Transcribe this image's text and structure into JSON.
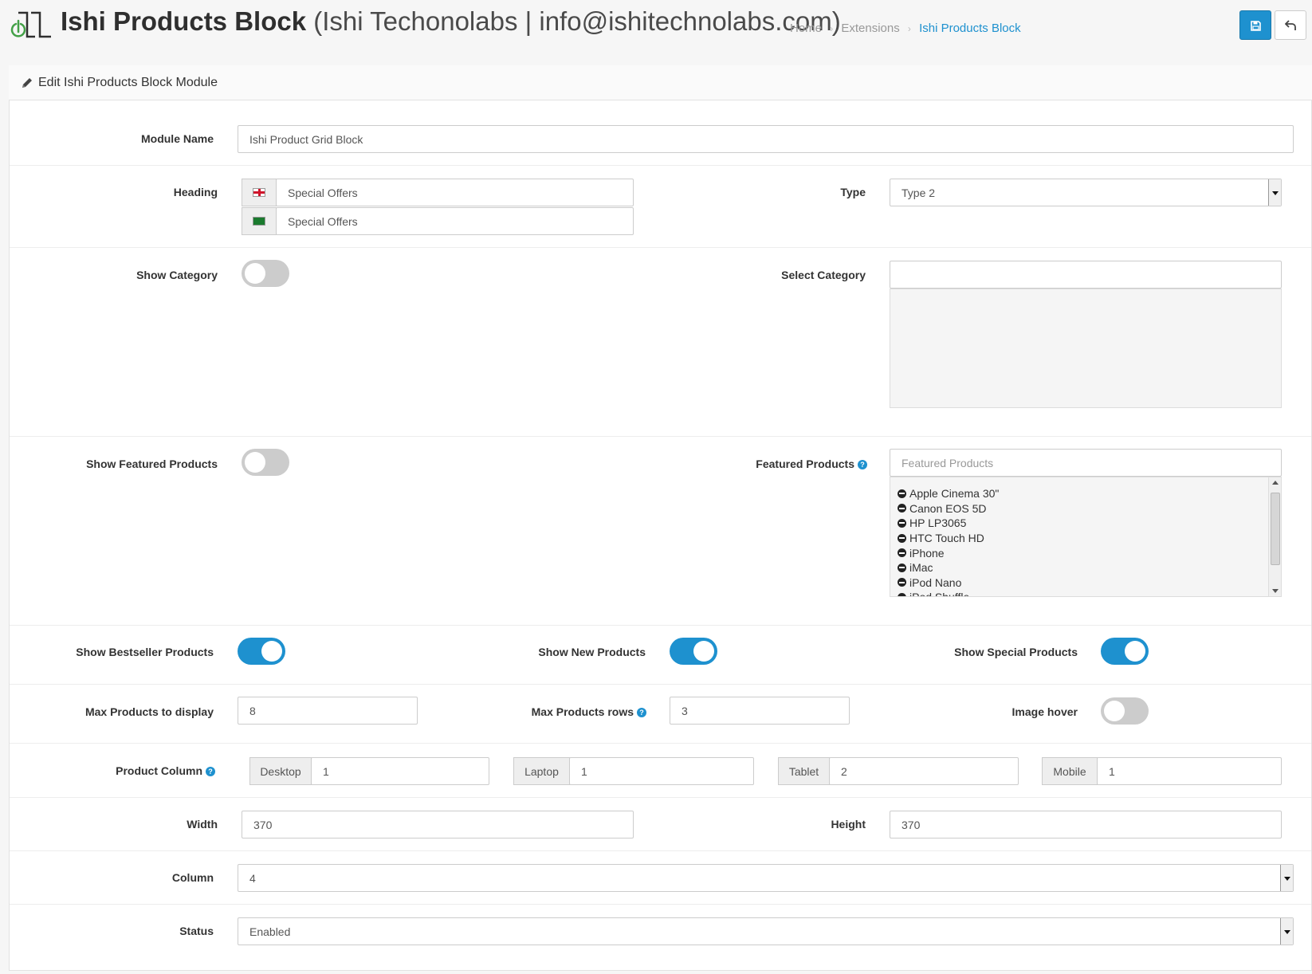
{
  "header": {
    "title": "Ishi Products Block",
    "subtitle": "(Ishi Techonolabs | info@ishitechnolabs.com)",
    "breadcrumb": [
      "Home",
      "Extensions",
      "Ishi Products Block"
    ]
  },
  "icons": {
    "logo": "ishi-logo-icon",
    "save": "save-icon",
    "back": "reply-icon",
    "pencil": "pencil-icon",
    "help": "question-circle-icon",
    "flag_en": "flag-gb-icon",
    "flag_ar": "flag-sa-icon",
    "remove": "minus-circle-icon"
  },
  "colors": {
    "primary": "#1e91cf",
    "toggle_off": "#cccccc"
  },
  "panel": {
    "title": "Edit Ishi Products Block Module"
  },
  "form": {
    "module_name": {
      "label": "Module Name",
      "value": "Ishi Product Grid Block"
    },
    "heading": {
      "label": "Heading",
      "values": [
        "Special Offers",
        "Special Offers"
      ]
    },
    "type": {
      "label": "Type",
      "value": "Type 2"
    },
    "show_category": {
      "label": "Show Category",
      "enabled": false
    },
    "select_category": {
      "label": "Select Category",
      "value": ""
    },
    "show_featured": {
      "label": "Show Featured Products",
      "enabled": false
    },
    "featured_products": {
      "label": "Featured Products",
      "placeholder": "Featured Products",
      "items": [
        "Apple Cinema 30\"",
        "Canon EOS 5D",
        "HP LP3065",
        "HTC Touch HD",
        "iPhone",
        "iMac",
        "iPod Nano",
        "iPod Shuffle"
      ]
    },
    "show_bestseller": {
      "label": "Show Bestseller Products",
      "enabled": true
    },
    "show_new": {
      "label": "Show New Products",
      "enabled": true
    },
    "show_special": {
      "label": "Show Special Products",
      "enabled": true
    },
    "max_products": {
      "label": "Max Products to display",
      "value": "8"
    },
    "max_rows": {
      "label": "Max Products rows",
      "value": "3"
    },
    "image_hover": {
      "label": "Image hover",
      "enabled": false
    },
    "product_column": {
      "label": "Product Column",
      "devices": [
        {
          "name": "Desktop",
          "value": "1"
        },
        {
          "name": "Laptop",
          "value": "1"
        },
        {
          "name": "Tablet",
          "value": "2"
        },
        {
          "name": "Mobile",
          "value": "1"
        }
      ]
    },
    "width": {
      "label": "Width",
      "value": "370"
    },
    "height": {
      "label": "Height",
      "value": "370"
    },
    "column": {
      "label": "Column",
      "value": "4"
    },
    "status": {
      "label": "Status",
      "value": "Enabled"
    }
  }
}
